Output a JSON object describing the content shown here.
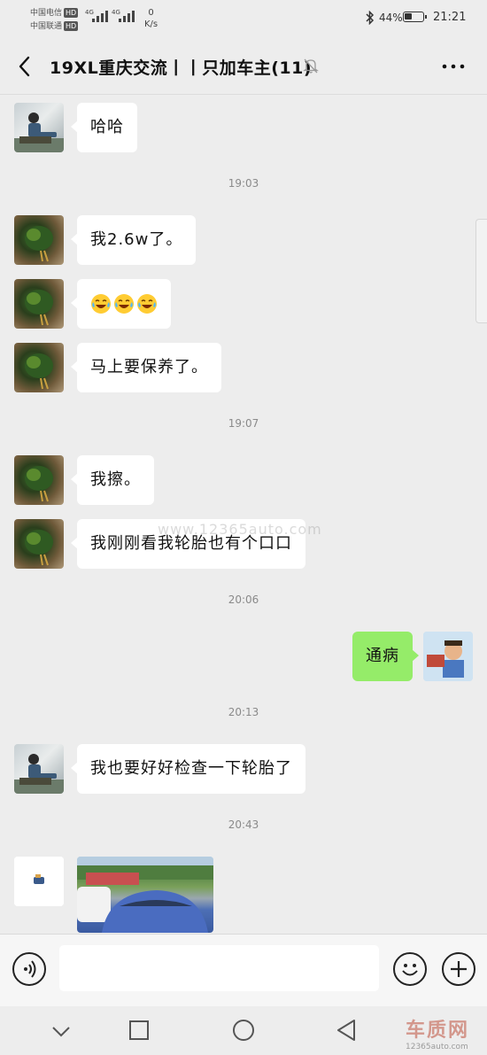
{
  "status_bar": {
    "carrier1": "中国电信",
    "carrier2": "中国联通",
    "hd_label": "HD",
    "sig1_label": "4G",
    "sig2_label": "4G",
    "net_speed_value": "0",
    "net_speed_unit": "K/s",
    "battery_pct": "44%",
    "battery_level": 0.44,
    "time": "21:21"
  },
  "header": {
    "title": "19XL重庆交流丨丨只加车主(11)",
    "muted": true
  },
  "messages": [
    {
      "type": "text",
      "side": "left",
      "avatar": "man-icon",
      "text": "哈哈"
    },
    {
      "type": "time",
      "text": "19:03"
    },
    {
      "type": "text",
      "side": "left",
      "avatar": "bird-icon",
      "text": "我2.6w了。"
    },
    {
      "type": "emoji",
      "side": "left",
      "avatar": "bird-icon",
      "emoji": "tears-of-joy-emoji",
      "count": 3
    },
    {
      "type": "text",
      "side": "left",
      "avatar": "bird-icon",
      "text": "马上要保养了。"
    },
    {
      "type": "time",
      "text": "19:07"
    },
    {
      "type": "text",
      "side": "left",
      "avatar": "bird-icon",
      "text": "我擦。"
    },
    {
      "type": "text",
      "side": "left",
      "avatar": "bird-icon",
      "text": "我刚刚看我轮胎也有个口口"
    },
    {
      "type": "time",
      "text": "20:06"
    },
    {
      "type": "text",
      "side": "right",
      "avatar": "cartoon-icon",
      "text": "通病"
    },
    {
      "type": "time",
      "text": "20:13"
    },
    {
      "type": "text",
      "side": "left",
      "avatar": "man-icon",
      "text": "我也要好好检查一下轮胎了"
    },
    {
      "type": "time",
      "text": "20:43"
    },
    {
      "type": "image",
      "side": "left",
      "avatar": "small-car-icon"
    }
  ],
  "input_bar": {
    "placeholder": "",
    "value": ""
  },
  "watermark": {
    "text": "www.12365auto.com",
    "logo_text": "车质网",
    "logo_url": "12365auto.com"
  },
  "colors": {
    "background": "#ededed",
    "bubble_left": "#ffffff",
    "bubble_right": "#95ec69"
  }
}
